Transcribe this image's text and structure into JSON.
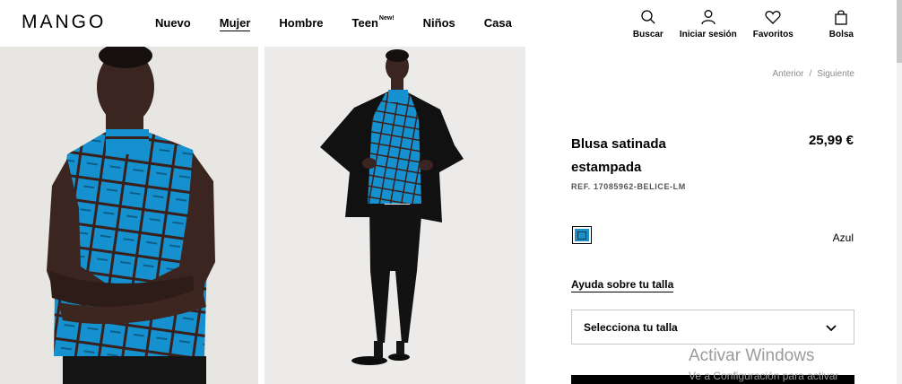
{
  "header": {
    "logo": "MANGO",
    "nav": [
      {
        "label": "Nuevo",
        "badge": ""
      },
      {
        "label": "Mujer",
        "badge": ""
      },
      {
        "label": "Hombre",
        "badge": ""
      },
      {
        "label": "Teen",
        "badge": "New!"
      },
      {
        "label": "Niños",
        "badge": ""
      },
      {
        "label": "Casa",
        "badge": ""
      }
    ],
    "actions": {
      "search": "Buscar",
      "login": "Iniciar sesión",
      "favorites": "Favoritos",
      "bag": "Bolsa"
    }
  },
  "product": {
    "prev": "Anterior",
    "separator": "/",
    "next": "Siguiente",
    "title": "Blusa satinada estampada",
    "price": "25,99 €",
    "ref": "REF. 17085962-BELICE-LM",
    "color_name": "Azul",
    "color_hex": "#1f8ec2",
    "size_help": "Ayuda sobre tu talla",
    "size_select": "Selecciona tu talla"
  },
  "watermark": {
    "line1": "Activar Windows",
    "line2": "Ve a Configuración para activar"
  },
  "colors": {
    "accent_blue": "#1591cf",
    "stripe_dark": "#3a1f1a"
  }
}
